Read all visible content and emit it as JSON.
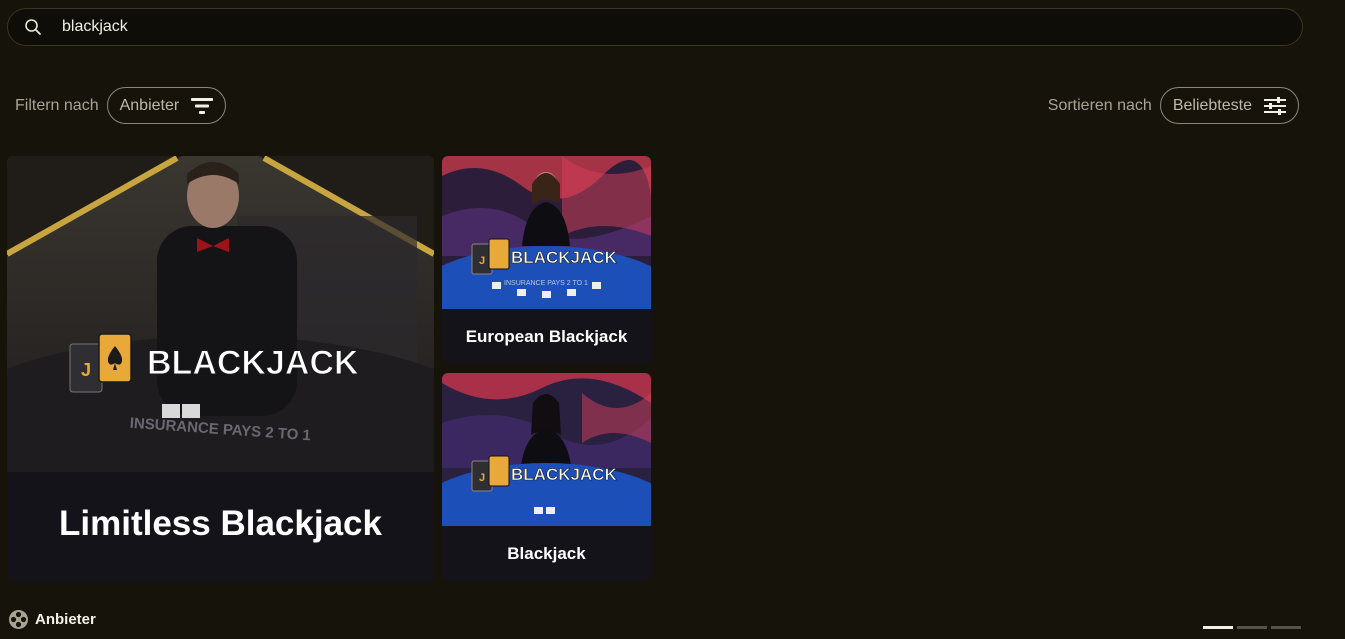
{
  "search": {
    "value": "blackjack",
    "icon": "search-icon"
  },
  "filter": {
    "label": "Filtern nach",
    "button_label": "Anbieter",
    "icon": "filter-funnel-icon"
  },
  "sort": {
    "label": "Sortieren nach",
    "button_label": "Beliebteste",
    "icon": "sliders-icon"
  },
  "games": [
    {
      "title": "Limitless Blackjack",
      "logo_text": "BLACKJACK",
      "felt_text": "INSURANCE PAYS 2 TO 1"
    },
    {
      "title": "European Blackjack",
      "logo_text": "BLACKJACK",
      "felt_text": "INSURANCE PAYS 2 TO 1"
    },
    {
      "title": "Blackjack",
      "logo_text": "BLACKJACK"
    }
  ],
  "providers": {
    "label": "Anbieter",
    "icon": "film-reel-icon"
  },
  "pager": {
    "pages": 3,
    "active": 0
  },
  "colors": {
    "background": "#16130a",
    "accent_gold": "#e8a93a",
    "felt_blue": "#1d4fb8"
  }
}
